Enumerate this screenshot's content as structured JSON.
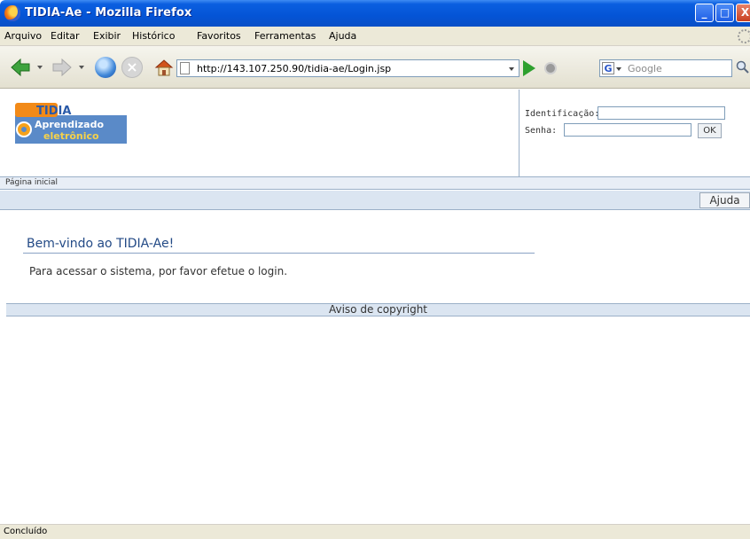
{
  "window": {
    "title": "TIDIA-Ae - Mozilla Firefox",
    "buttons": {
      "minimize": "_",
      "maximize": "□",
      "close": "X"
    }
  },
  "menubar": {
    "items": [
      "Arquivo",
      "Editar",
      "Exibir",
      "Histórico",
      "Favoritos",
      "Ferramentas",
      "Ajuda"
    ]
  },
  "toolbar": {
    "url": "http://143.107.250.90/tidia-ae/Login.jsp",
    "search_engine": "G",
    "search_placeholder": "Google",
    "stop_glyph": "×"
  },
  "logo": {
    "line1": "Aprendizado",
    "line2": "eletrônico",
    "brand": "TIDIA",
    "tag": "Ae"
  },
  "login": {
    "id_label": "Identificação:",
    "password_label": "Senha:",
    "ok_label": "OK",
    "id_value": "",
    "password_value": ""
  },
  "breadcrumb": {
    "home": "Página inicial"
  },
  "help": {
    "label": "Ajuda"
  },
  "content": {
    "title": "Bem-vindo ao TIDIA-Ae!",
    "message": "Para acessar o sistema, por favor efetue o login."
  },
  "footer": {
    "copyright": "Aviso de copyright"
  },
  "status": {
    "text": "Concluído"
  },
  "colors": {
    "titlebar": "#0454d6",
    "heading": "#234a86",
    "bar": "#dbe5f1",
    "border": "#9bb0c8"
  }
}
